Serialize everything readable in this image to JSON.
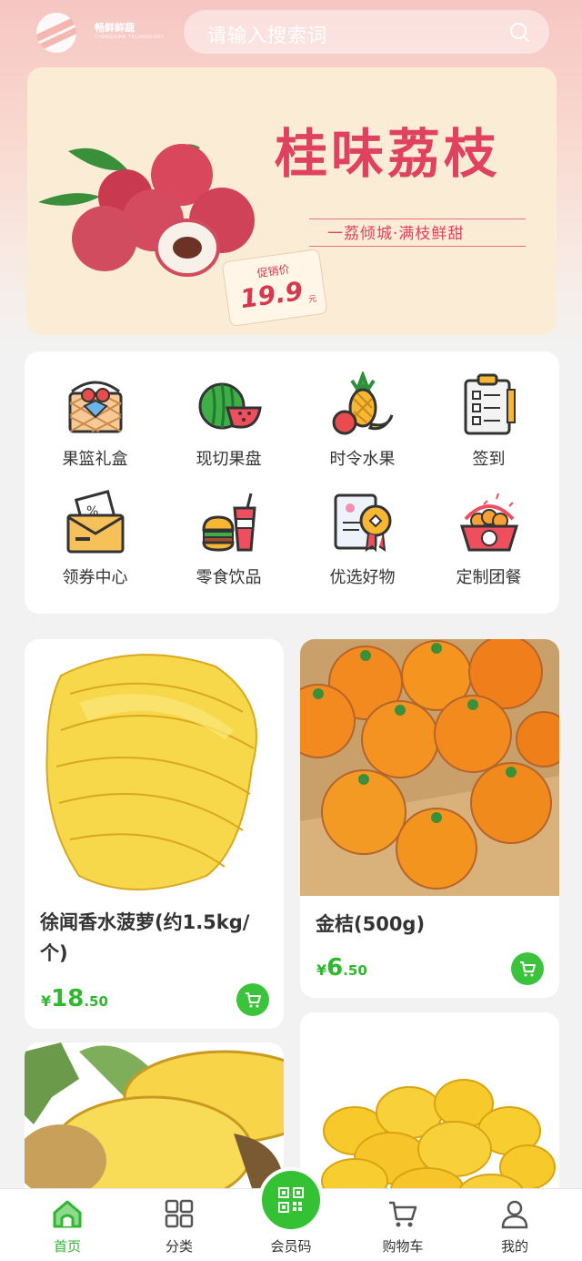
{
  "header": {
    "logo_name": "畅鲜鲜蔬",
    "logo_sub": "CHANGXIAN TECHNOLOGY",
    "search_placeholder": "请输入搜索词"
  },
  "banner": {
    "title": "桂味荔枝",
    "subtitle": "一荔倾城·满枝鲜甜",
    "tag_label": "促销价",
    "tag_price": "19.9",
    "tag_unit": "元"
  },
  "categories": [
    {
      "label": "果篮礼盒",
      "icon": "fruit-basket-icon"
    },
    {
      "label": "现切果盘",
      "icon": "watermelon-icon"
    },
    {
      "label": "时令水果",
      "icon": "seasonal-fruit-icon"
    },
    {
      "label": "签到",
      "icon": "checklist-icon"
    },
    {
      "label": "领券中心",
      "icon": "coupon-icon"
    },
    {
      "label": "零食饮品",
      "icon": "snack-drink-icon"
    },
    {
      "label": "优选好物",
      "icon": "certificate-icon"
    },
    {
      "label": "定制团餐",
      "icon": "group-meal-icon"
    }
  ],
  "products": [
    {
      "name_line1": "徐闻香水菠萝(约1.5kg/",
      "name_line2": "个)",
      "yen": "¥",
      "price_int": "18",
      "price_dec": ".50"
    },
    {
      "name_line1": "金桔(500g)",
      "name_line2": "",
      "yen": "¥",
      "price_int": "6",
      "price_dec": ".50"
    }
  ],
  "tabbar": [
    {
      "label": "首页",
      "icon": "home-icon",
      "active": true
    },
    {
      "label": "分类",
      "icon": "category-grid-icon"
    },
    {
      "label": "会员码",
      "icon": "qr-code-icon"
    },
    {
      "label": "购物车",
      "icon": "cart-icon"
    },
    {
      "label": "我的",
      "icon": "user-icon"
    }
  ],
  "colors": {
    "accent_green": "#2eb82e",
    "banner_red": "#e0415f",
    "banner_bg": "#fbecd6"
  }
}
